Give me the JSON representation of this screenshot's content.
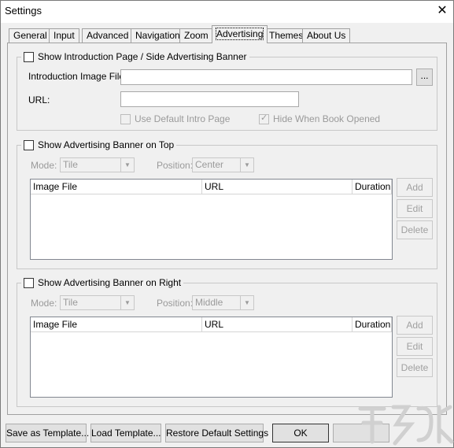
{
  "window": {
    "title": "Settings",
    "close_glyph": "✕"
  },
  "tabs": [
    {
      "label": "General"
    },
    {
      "label": "Input"
    },
    {
      "label": "Advanced"
    },
    {
      "label": "Navigation"
    },
    {
      "label": "Zoom"
    },
    {
      "label": "Advertising"
    },
    {
      "label": "Themes"
    },
    {
      "label": "About Us"
    }
  ],
  "active_tab": "Advertising",
  "intro_group": {
    "checkbox_label": "Show Introduction Page / Side Advertising Banner",
    "checked": false,
    "image_file_label": "Introduction Image File:",
    "image_file_value": "",
    "browse_label": "...",
    "url_label": "URL:",
    "url_value": "",
    "use_default_label": "Use Default Intro Page",
    "use_default_checked": false,
    "hide_when_opened_label": "Hide When Book Opened",
    "hide_when_opened_checked": true
  },
  "top_banner": {
    "checkbox_label": "Show Advertising Banner on Top",
    "checked": false,
    "mode_label": "Mode:",
    "mode_value": "Tile",
    "position_label": "Position:",
    "position_value": "Center",
    "columns": [
      "Image File",
      "URL",
      "Duration"
    ],
    "add_label": "Add",
    "edit_label": "Edit",
    "delete_label": "Delete"
  },
  "right_banner": {
    "checkbox_label": "Show Advertising Banner on Right",
    "checked": false,
    "mode_label": "Mode:",
    "mode_value": "Tile",
    "position_label": "Position:",
    "position_value": "Middle",
    "columns": [
      "Image File",
      "URL",
      "Duration"
    ],
    "add_label": "Add",
    "edit_label": "Edit",
    "delete_label": "Delete"
  },
  "footer": {
    "save_template": "Save as Template...",
    "load_template": "Load Template...",
    "restore_defaults": "Restore Default Settings",
    "ok": "OK"
  },
  "colors": {
    "window_bg": "#f0f0f0",
    "disabled_text": "#9a9a9a",
    "border": "#a0a0a0"
  }
}
